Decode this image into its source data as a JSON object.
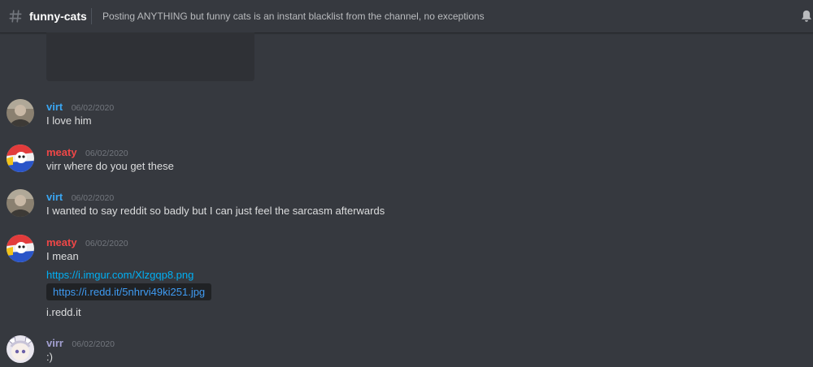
{
  "header": {
    "channel": "funny-cats",
    "topic": "Posting ANYTHING but funny cats is an instant blacklist from the channel, no exceptions"
  },
  "colors": {
    "background": "#36393f",
    "virt": "#3aa6f2",
    "meaty": "#f04747",
    "virr": "#a3a0d1",
    "link": "#00b0f4",
    "timestamp": "#72767d"
  },
  "messages": [
    {
      "author": "virt",
      "timestamp": "06/02/2020",
      "lines": [
        "I love him"
      ]
    },
    {
      "author": "meaty",
      "timestamp": "06/02/2020",
      "lines": [
        "virr where do you get these"
      ]
    },
    {
      "author": "virt",
      "timestamp": "06/02/2020",
      "lines": [
        "I wanted to say reddit so badly but I can just feel the sarcasm afterwards"
      ]
    },
    {
      "author": "meaty",
      "timestamp": "06/02/2020",
      "lines": [
        "I mean",
        "https://i.imgur.com/Xlzgqp8.png",
        "https://i.redd.it/5nhrvi49ki251.jpg",
        "i.redd.it"
      ]
    },
    {
      "author": "virr",
      "timestamp": "06/02/2020",
      "lines": [
        ":)"
      ]
    }
  ],
  "icons": {
    "channel": "hash-icon",
    "notifications": "bell-icon"
  }
}
